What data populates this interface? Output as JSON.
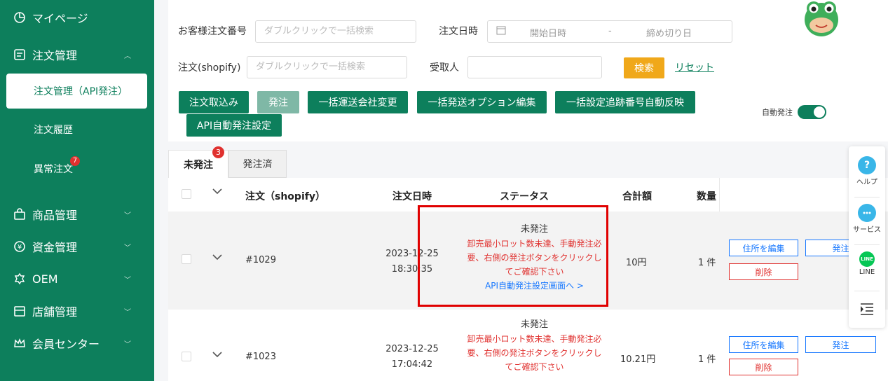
{
  "sidebar": {
    "bg_color": "#0d7f5c",
    "items": [
      {
        "label": "マイページ",
        "icon": "pie-chart-icon"
      },
      {
        "label": "注文管理",
        "icon": "list-box-icon"
      },
      {
        "label": "商品管理",
        "icon": "shopping-bag-icon"
      },
      {
        "label": "資金管理",
        "icon": "yen-coin-icon"
      },
      {
        "label": "OEM",
        "icon": "oem-badge-icon"
      },
      {
        "label": "店舗管理",
        "icon": "store-icon"
      },
      {
        "label": "会員センター",
        "icon": "crown-icon"
      }
    ],
    "sub_items": [
      {
        "label": "注文管理（API発注）"
      },
      {
        "label": "注文履歴"
      },
      {
        "label": "異常注文",
        "badge": "7"
      }
    ]
  },
  "filters": {
    "customer_order_label": "お客様注文番号",
    "customer_order_placeholder": "ダブルクリックで一括検索",
    "order_date_label": "注文日時",
    "start_date_placeholder": "開始日時",
    "date_separator": "-",
    "end_date_placeholder": "締め切り日",
    "shopify_order_label": "注文(shopify)",
    "shopify_order_placeholder": "ダブルクリックで一括検索",
    "recipient_label": "受取人",
    "recipient_value": "",
    "search_button": "検索",
    "reset_link": "リセット"
  },
  "actions": {
    "import": "注文取込み",
    "order": "発注",
    "bulk_carrier": "一括運送会社変更",
    "bulk_options": "一括発送オプション編集",
    "bulk_tracking": "一括設定追跡番号自動反映",
    "api_auto": "API自動発注設定",
    "auto_order_label": "自動発注",
    "auto_order_on": true
  },
  "tabs": [
    {
      "label": "未発注",
      "badge": "3",
      "active": true
    },
    {
      "label": "発注済",
      "active": false
    }
  ],
  "table": {
    "headers": {
      "order": "注文（shopify）",
      "date": "注文日時",
      "status": "ステータス",
      "total": "合計額",
      "qty": "数量"
    },
    "rows": [
      {
        "order_no": "#1029",
        "date": "2023-12-25",
        "time": "18:30:35",
        "status": "未発注",
        "warn1": "卸売最小ロット数未達、手動発注必",
        "warn2": "要、右側の発注ボタンをクリックし",
        "warn3": "てご確認下さい",
        "link": "API自動発注設定画面へ >",
        "total": "10円",
        "qty": "1 件",
        "edit_address": "住所を編集",
        "order_btn": "発注",
        "delete_btn": "削除"
      },
      {
        "order_no": "#1023",
        "date": "2023-12-25",
        "time": "17:04:42",
        "status": "未発注",
        "warn1": "卸売最小ロット数未達、手動発注必",
        "warn2": "要、右側の発注ボタンをクリックし",
        "warn3": "てご確認下さい",
        "total": "10.21円",
        "qty": "1 件",
        "edit_address": "住所を編集",
        "order_btn": "発注",
        "delete_btn": "削除"
      }
    ]
  },
  "float_bar": [
    {
      "label": "ヘルプ",
      "icon": "help-icon"
    },
    {
      "label": "サービス",
      "icon": "chat-icon"
    },
    {
      "label": "LINE",
      "icon": "line-icon",
      "badge_text": "LINE"
    },
    {
      "label": "",
      "icon": "indent-menu-icon"
    }
  ]
}
